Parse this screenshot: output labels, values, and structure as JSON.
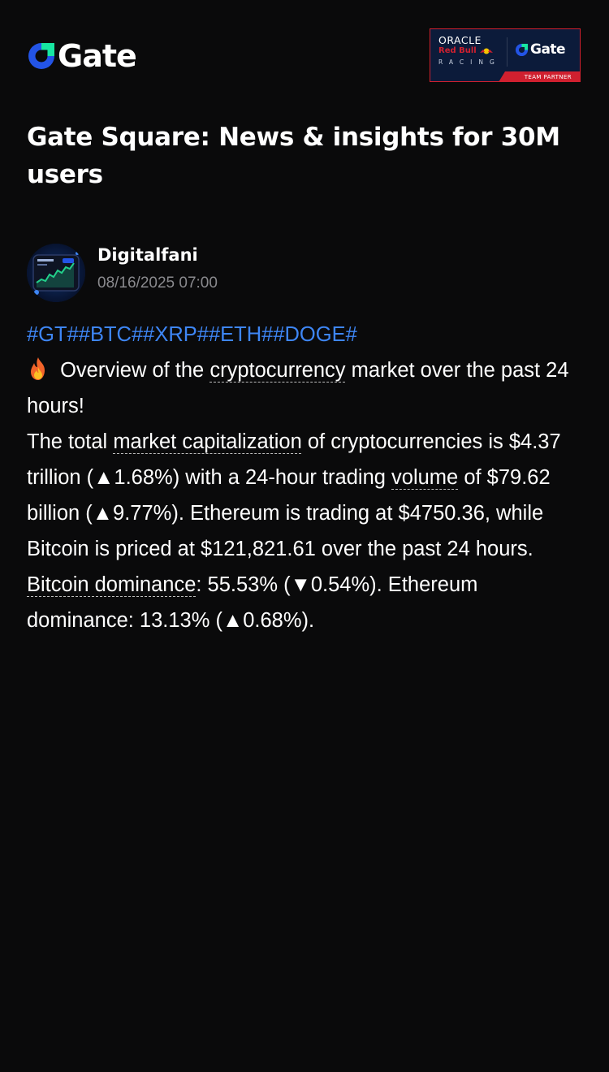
{
  "brand": {
    "name": "Gate",
    "logo_icon": "gate-g-icon",
    "accent_colors": [
      "#2354e6",
      "#17e6a1"
    ]
  },
  "partner": {
    "line1": "ORACLE",
    "line2": "Red Bull",
    "line3": "RACING",
    "gate_label": "Gate",
    "strip_label": "TEAM PARTNER",
    "border_color": "#d0202f",
    "bg_color": "#0c1b3a"
  },
  "page": {
    "title": "Gate Square: News & insights for 30M users"
  },
  "author": {
    "name": "Digitalfani",
    "timestamp": "08/16/2025 07:00",
    "avatar_icon": "trading-chart-avatar"
  },
  "post": {
    "hashtags": [
      "#GT#",
      "#BTC#",
      "#XRP#",
      "#ETH#",
      "#DOGE#"
    ],
    "hashtag_color": "#3e86f5",
    "emoji": "🔥",
    "p1_text": " Overview of the ",
    "p1_term": "cryptocurrency",
    "p1_tail": " market over the past 24 hours!",
    "p2_a": "The total ",
    "p2_term1": "market capitalization",
    "p2_b": " of cryptocurrencies is $4.37 trillion (▲1.68%) with a 24-hour trading ",
    "p2_term2": "volume",
    "p2_c": " of $79.62 billion (▲9.77%). Ethereum is trading at $4750.36, while Bitcoin is priced at $121,821.61 over the past 24 hours. ",
    "p2_term3": "Bitcoin dominance",
    "p2_d": ": 55.53% (▼0.54%). Ethereum dominance: 13.13% (▲0.68%)."
  }
}
